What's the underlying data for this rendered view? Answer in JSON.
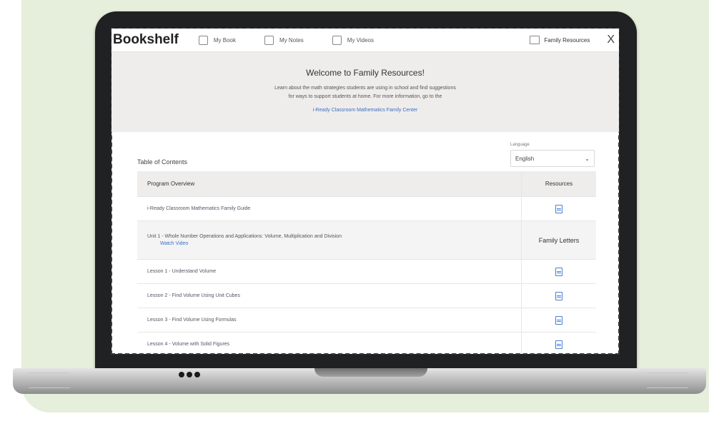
{
  "app": {
    "brand": "Bookshelf",
    "nav": [
      {
        "label": "My Book",
        "icon": "book-icon"
      },
      {
        "label": "My Notes",
        "icon": "notes-icon"
      },
      {
        "label": "My Videos",
        "icon": "video-icon"
      }
    ],
    "active_view": {
      "label": "Family Resources",
      "icon": "family-resources-icon"
    },
    "close_label": "X"
  },
  "welcome": {
    "title": "Welcome to Family Resources!",
    "line1": "Learn about the math strategies students are using in school and find suggestions",
    "line2": "for ways to support students at home. For more information, go to the",
    "link": "i-Ready Classroom Mathematics Family Center"
  },
  "toc": {
    "title": "Table of Contents",
    "language_label": "Language",
    "language_value": "English",
    "header": {
      "overview": "Program Overview",
      "resources": "Resources"
    },
    "rows": [
      {
        "kind": "item",
        "label": "i-Ready Classroom Mathematics Family Guide",
        "resource": "doc-icon"
      },
      {
        "kind": "unit",
        "label": "Unit 1 - Whole Number Operations and Applications: Volume, Multiplication and Division",
        "link": "Watch Video",
        "resource_text": "Family Letters"
      },
      {
        "kind": "item",
        "label": "Lesson 1 - Understand Volume",
        "resource": "doc-icon"
      },
      {
        "kind": "item",
        "label": "Lesson 2 - Find Volume Using Unit Cubes",
        "resource": "doc-icon"
      },
      {
        "kind": "item",
        "label": "Lesson 3 - Find Volume Using Formulas",
        "resource": "doc-icon"
      },
      {
        "kind": "item",
        "label": "Lesson 4 - Volume with Solid Figures",
        "resource": "doc-icon"
      }
    ]
  },
  "colors": {
    "background_panel": "#e6eedc",
    "laptop_lid": "#202122",
    "header_band": "#efedeb",
    "link": "#3b6fc4"
  }
}
